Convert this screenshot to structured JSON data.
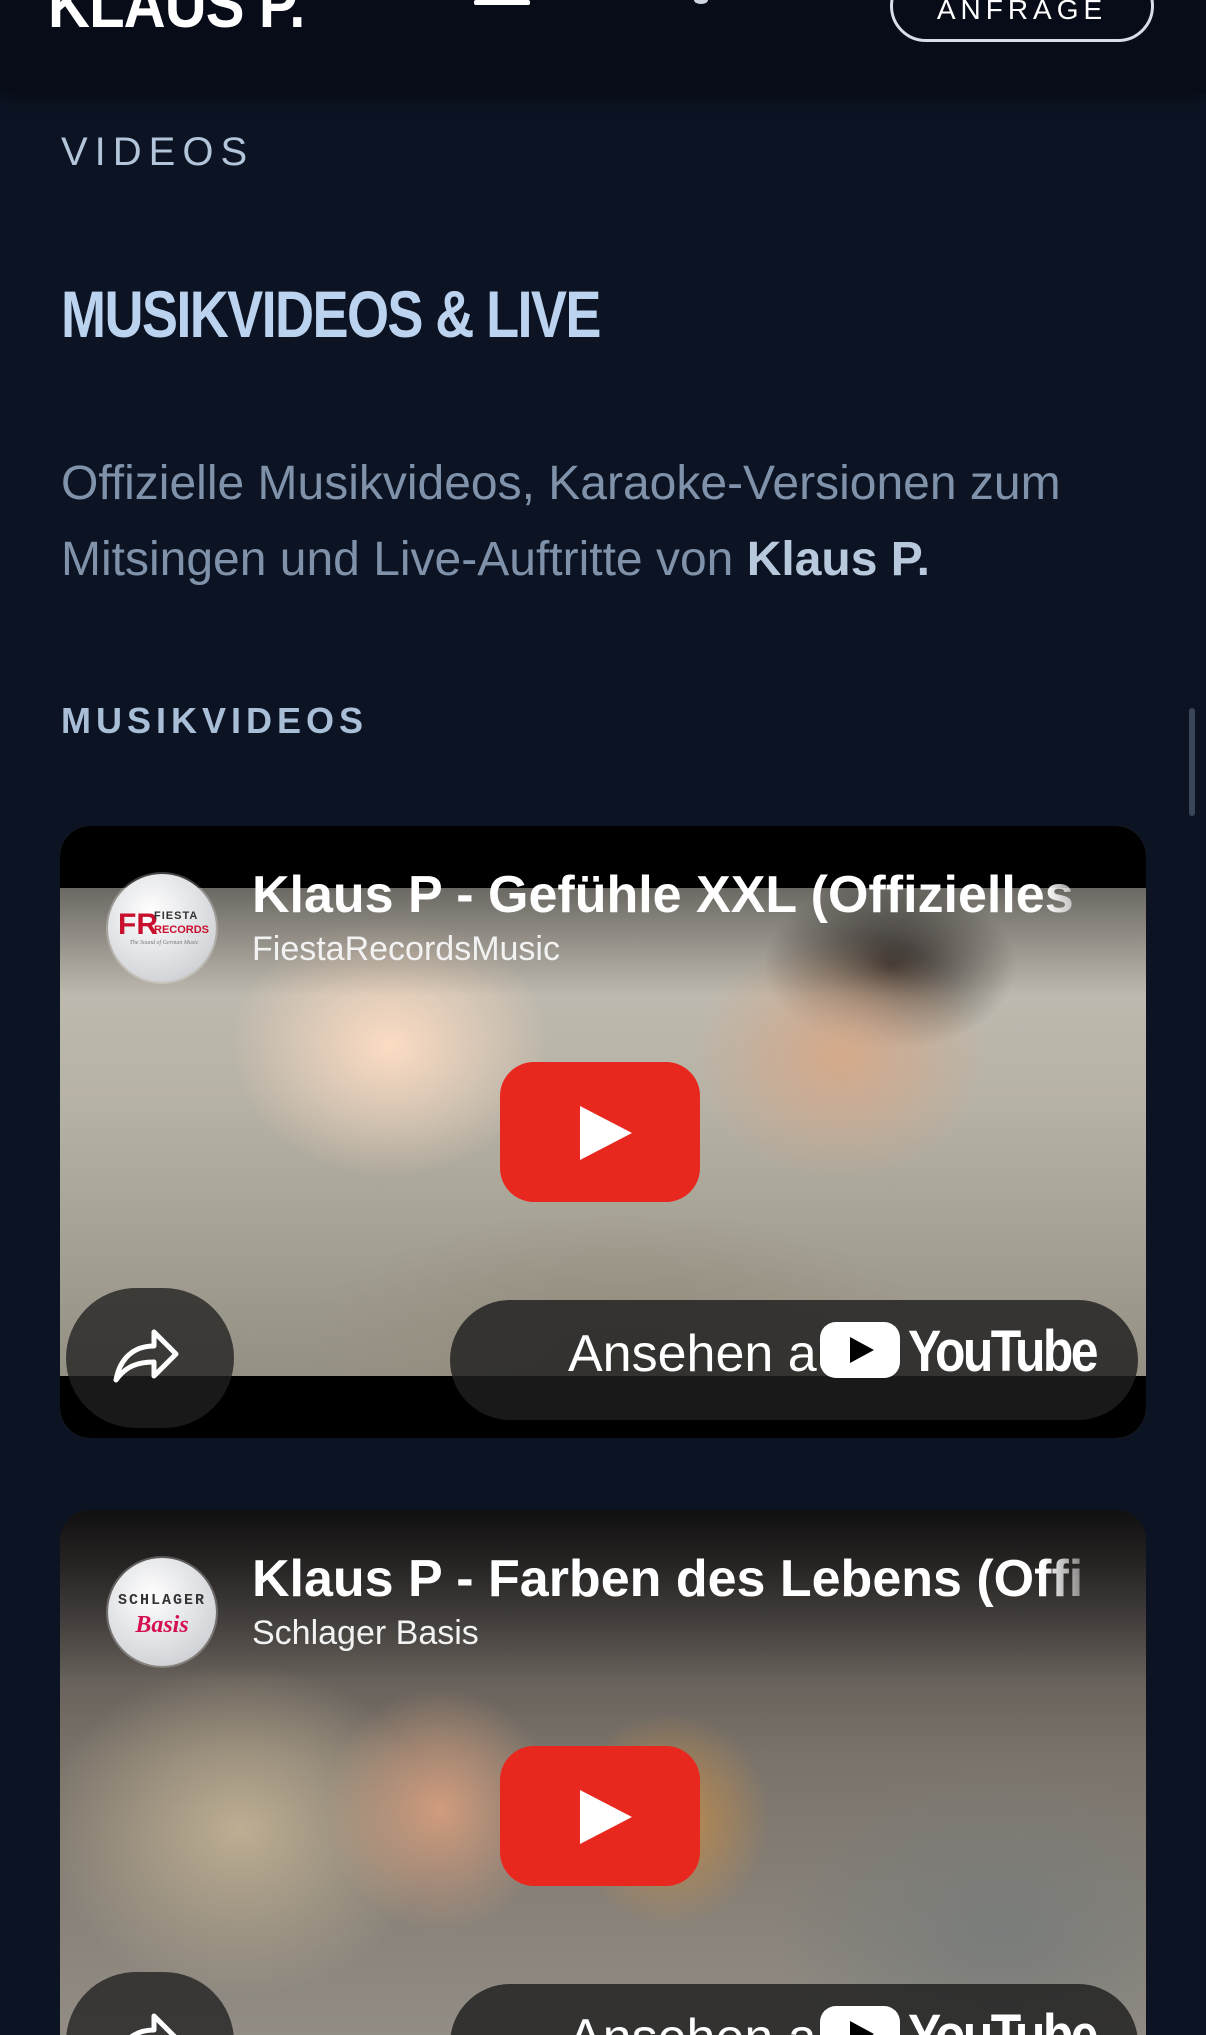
{
  "header": {
    "logo": "KLAUS P.",
    "cta_label": "ANFRAGE"
  },
  "section": {
    "eyebrow": "VIDEOS",
    "heading": "MUSIKVIDEOS & LIVE",
    "intro_text": "Offizielle Musikvideos, Karaoke-Versionen zum Mitsingen und Live-Auftritte von ",
    "intro_strong": "Klaus P.",
    "subhead": "MUSIKVIDEOS"
  },
  "videos": [
    {
      "title": "Klaus P - Gefühle XXL (Offizielles",
      "channel": "FiestaRecordsMusic",
      "avatar_mark": "FR",
      "avatar_line1": "FIESTA",
      "avatar_line2": "RECORDS",
      "avatar_tagline": "The Sound of German Music",
      "watch_label": "Ansehen auf",
      "platform": "YouTube"
    },
    {
      "title": "Klaus P - Farben des Lebens (Offi",
      "channel": "Schlager Basis",
      "avatar_line1": "SCHLAGER",
      "avatar_line2": "Basis",
      "watch_label": "Ansehen auf",
      "platform": "YouTube"
    }
  ],
  "colors": {
    "background": "#0c1424",
    "header_bg": "#070c18",
    "heading": "#bcd3f0",
    "body_text": "#8092aa",
    "youtube_red": "#e8281e"
  },
  "icons": {
    "menu": "hamburger-icon",
    "share": "share-arrow-icon",
    "play": "play-icon",
    "youtube": "youtube-logo-icon"
  }
}
